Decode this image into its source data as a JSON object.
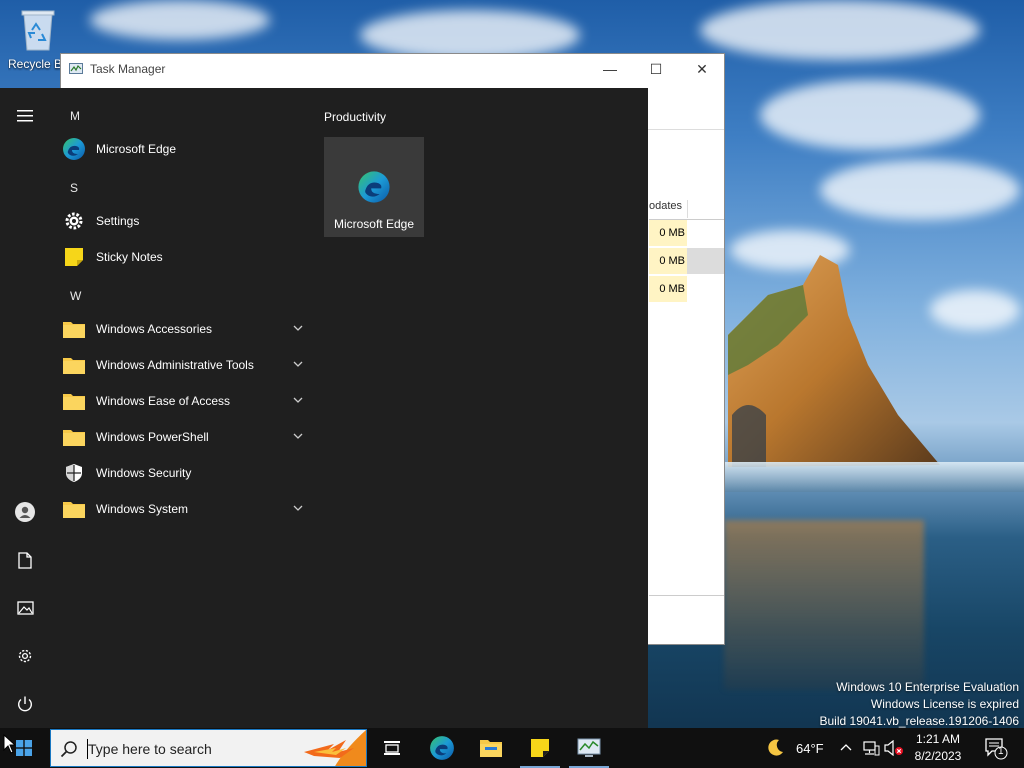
{
  "desktop": {
    "recycle_bin_label": "Recycle Bin",
    "watermark": {
      "line1": "Windows 10 Enterprise Evaluation",
      "line2": "Windows License is expired",
      "line3": "Build 19041.vb_release.191206-1406"
    }
  },
  "task_manager": {
    "title": "Task Manager",
    "minimize_glyph": "—",
    "maximize_glyph": "☐",
    "close_glyph": "✕",
    "column_header": "odates",
    "cells": [
      "0 MB",
      "0 MB",
      "0 MB"
    ]
  },
  "start_menu": {
    "sections": [
      {
        "letter": "M",
        "apps": [
          {
            "name": "Microsoft Edge",
            "icon": "edge-icon"
          }
        ]
      },
      {
        "letter": "S",
        "apps": [
          {
            "name": "Settings",
            "icon": "gear-icon"
          },
          {
            "name": "Sticky Notes",
            "icon": "sticky-notes-icon"
          }
        ]
      },
      {
        "letter": "W",
        "apps": [
          {
            "name": "Windows Accessories",
            "icon": "folder-icon",
            "expandable": true
          },
          {
            "name": "Windows Administrative Tools",
            "icon": "folder-icon",
            "expandable": true
          },
          {
            "name": "Windows Ease of Access",
            "icon": "folder-icon",
            "expandable": true
          },
          {
            "name": "Windows PowerShell",
            "icon": "folder-icon",
            "expandable": true
          },
          {
            "name": "Windows Security",
            "icon": "shield-icon",
            "expandable": false
          },
          {
            "name": "Windows System",
            "icon": "folder-icon",
            "expandable": true
          }
        ]
      }
    ],
    "tiles_group": "Productivity",
    "tiles": [
      {
        "name": "Microsoft Edge",
        "icon": "edge-icon"
      }
    ],
    "rail": [
      "hamburger-icon",
      "user-icon",
      "documents-icon",
      "pictures-icon",
      "settings-icon",
      "power-icon"
    ]
  },
  "taskbar": {
    "search_placeholder": "Type here to search",
    "pinned": [
      "task-view-icon",
      "edge-icon",
      "file-explorer-icon",
      "sticky-notes-icon",
      "task-manager-icon"
    ],
    "weather": "64°F",
    "time": "1:21 AM",
    "date": "8/2/2023",
    "notification_count": "1"
  },
  "colors": {
    "start_bg": "#1f1f1f",
    "taskbar_bg": "#101010",
    "folder": "#f7c948",
    "accent": "#1a78c2"
  }
}
